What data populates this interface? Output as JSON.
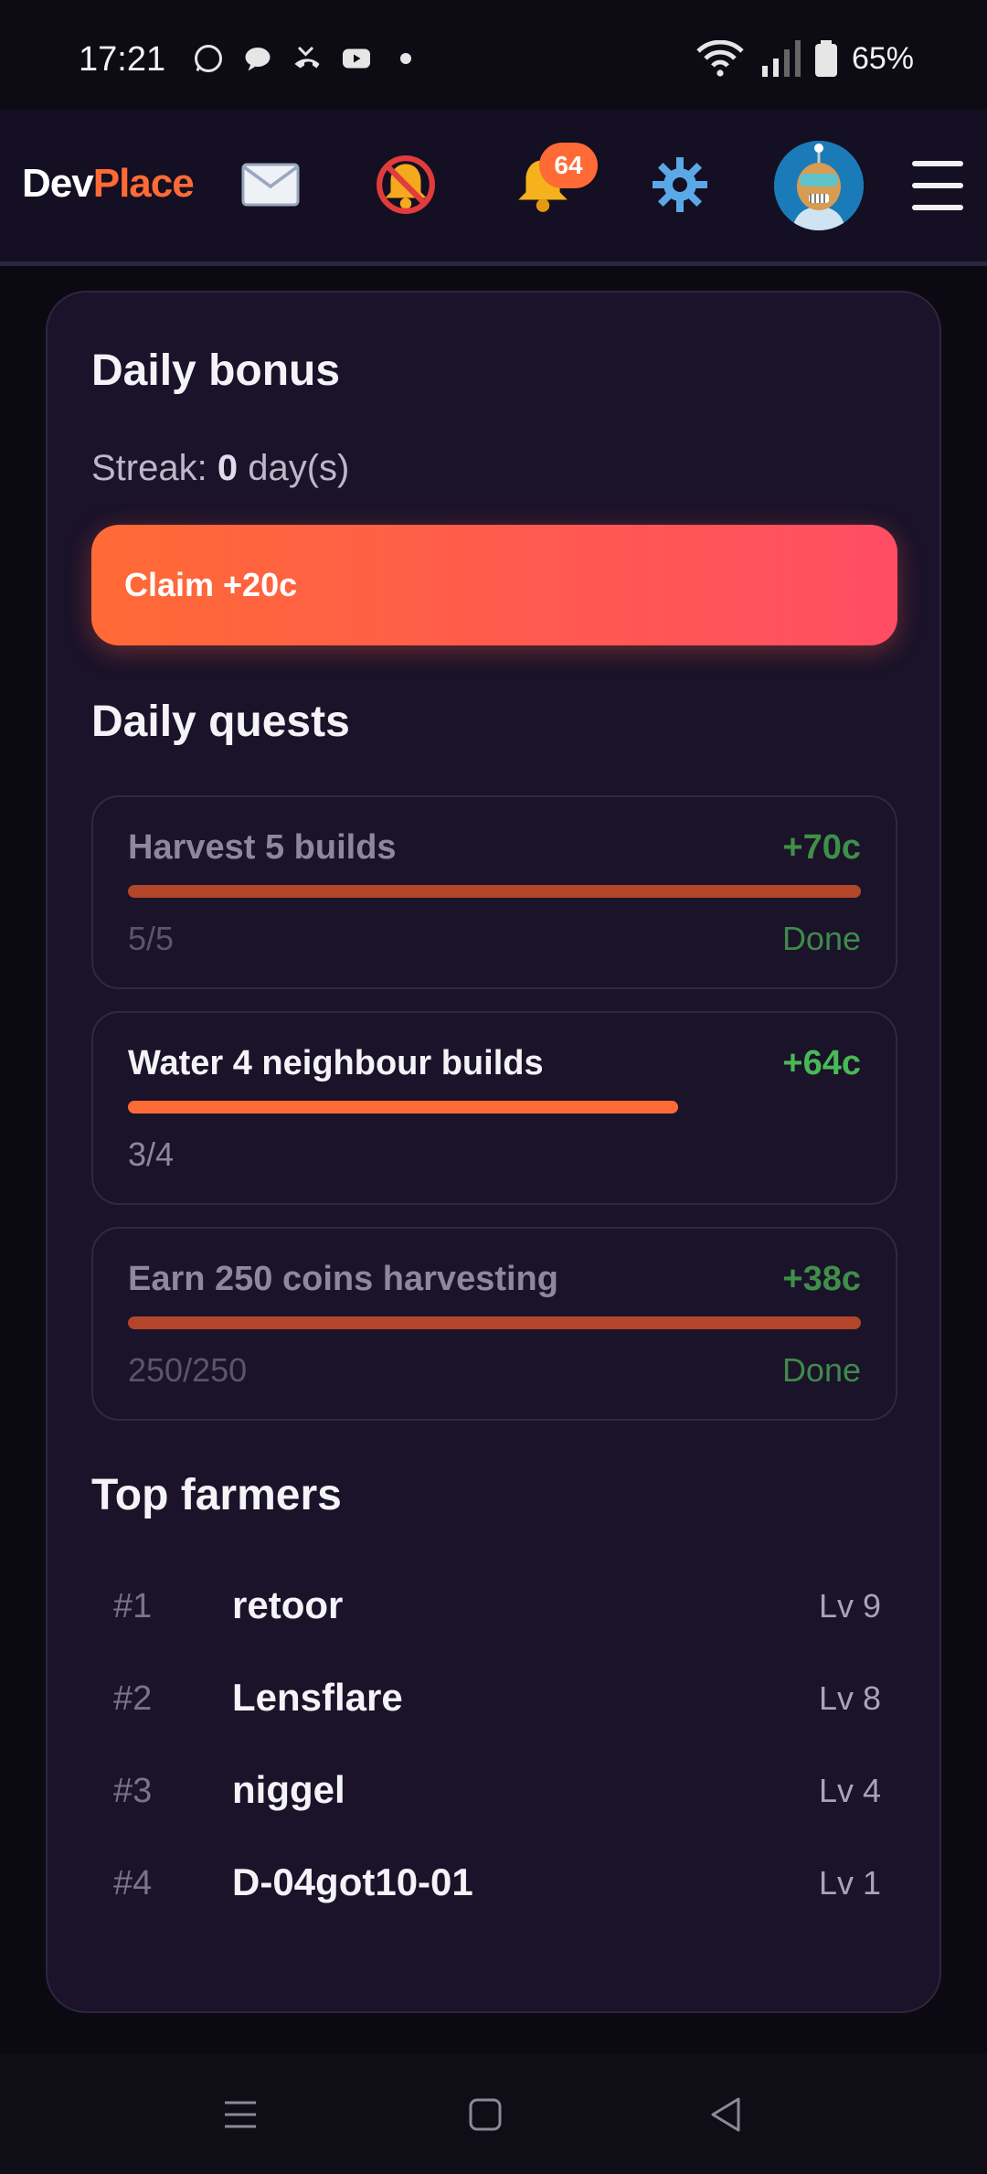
{
  "status_bar": {
    "time": "17:21",
    "battery": "65%"
  },
  "header": {
    "logo_part1": "Dev",
    "logo_part2": "Place",
    "notification_count": "64",
    "icons": [
      "mail-icon",
      "notifications-muted-icon",
      "bell-icon",
      "gear-icon",
      "avatar",
      "hamburger-menu-icon"
    ]
  },
  "daily_bonus": {
    "title": "Daily bonus",
    "streak_prefix": "Streak:",
    "streak_value": "0",
    "streak_suffix": "day(s)",
    "claim_label": "Claim +20c"
  },
  "daily_quests": {
    "title": "Daily quests",
    "items": [
      {
        "title": "Harvest 5 builds",
        "reward": "+70c",
        "count": "5/5",
        "status": "Done",
        "progress": 1.0
      },
      {
        "title": "Water 4 neighbour builds",
        "reward": "+64c",
        "count": "3/4",
        "status": "",
        "progress": 0.75
      },
      {
        "title": "Earn 250 coins harvesting",
        "reward": "+38c",
        "count": "250/250",
        "status": "Done",
        "progress": 1.0
      }
    ]
  },
  "top_farmers": {
    "title": "Top farmers",
    "rows": [
      {
        "rank": "#1",
        "name": "retoor",
        "level": "Lv 9"
      },
      {
        "rank": "#2",
        "name": "Lensflare",
        "level": "Lv 8"
      },
      {
        "rank": "#3",
        "name": "niggel",
        "level": "Lv 4"
      },
      {
        "rank": "#4",
        "name": "D-04got10-01",
        "level": "Lv 1"
      }
    ]
  },
  "colors": {
    "accent": "#ff6a35",
    "accent_end": "#ff4d64",
    "reward_green": "#49b858",
    "card_bg": "#1a1329"
  }
}
